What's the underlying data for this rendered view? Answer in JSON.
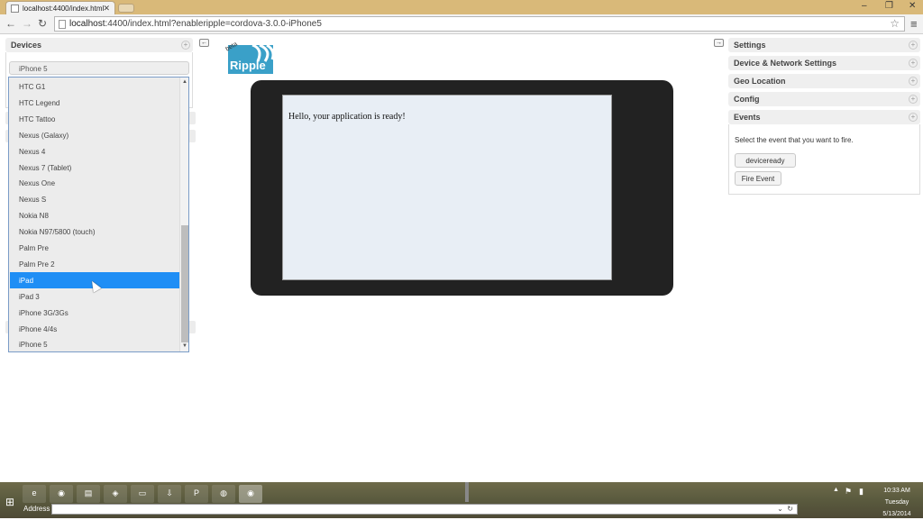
{
  "browser": {
    "tab_title": "localhost:4400/index.html",
    "tab_close": "✕",
    "url_host": "localhost",
    "url_rest": ":4400/index.html?enableripple=cordova-3.0.0-iPhone5",
    "back_glyph": "←",
    "forward_glyph": "→",
    "reload_glyph": "↻",
    "star_glyph": "☆",
    "menu_glyph": "≡",
    "window_controls": [
      "–",
      "❐",
      "✕"
    ]
  },
  "left_panel": {
    "title": "Devices",
    "selected_device": "iPhone 5",
    "collapse_glyph": "←",
    "plus_glyph": "+"
  },
  "dropdown": {
    "items": [
      "HTC G1",
      "HTC Legend",
      "HTC Tattoo",
      "Nexus (Galaxy)",
      "Nexus 4",
      "Nexus 7 (Tablet)",
      "Nexus One",
      "Nexus S",
      "Nokia N8",
      "Nokia N97/5800 (touch)",
      "Palm Pre",
      "Palm Pre 2",
      "iPad",
      "iPad 3",
      "iPhone 3G/3Gs",
      "iPhone 4/4s",
      "iPhone 5"
    ],
    "highlighted": "iPad",
    "scroll_up": "▲",
    "scroll_down": "▼"
  },
  "logo": {
    "text": "Ripple",
    "badge": "beta",
    "color": "#3aa0c8"
  },
  "device_screen": {
    "message": "Hello, your application is ready!"
  },
  "right_panel": {
    "collapse_glyph": "→",
    "sections": [
      "Settings",
      "Device & Network Settings",
      "Geo Location",
      "Config",
      "Events"
    ],
    "events_instruction": "Select the event that you want to fire.",
    "event_selected": "deviceready",
    "fire_button": "Fire Event"
  },
  "taskbar": {
    "start_glyph": "⊞",
    "address_label": "Address",
    "address_dropdown": "⌄",
    "address_refresh": "↻",
    "time": "10:33 AM",
    "day": "Tuesday",
    "date": "5/13/2014",
    "tray_up": "▲",
    "icons": [
      "e",
      "◉",
      "▤",
      "◈",
      "▭",
      "⇩",
      "P",
      "◍",
      "◉"
    ]
  }
}
